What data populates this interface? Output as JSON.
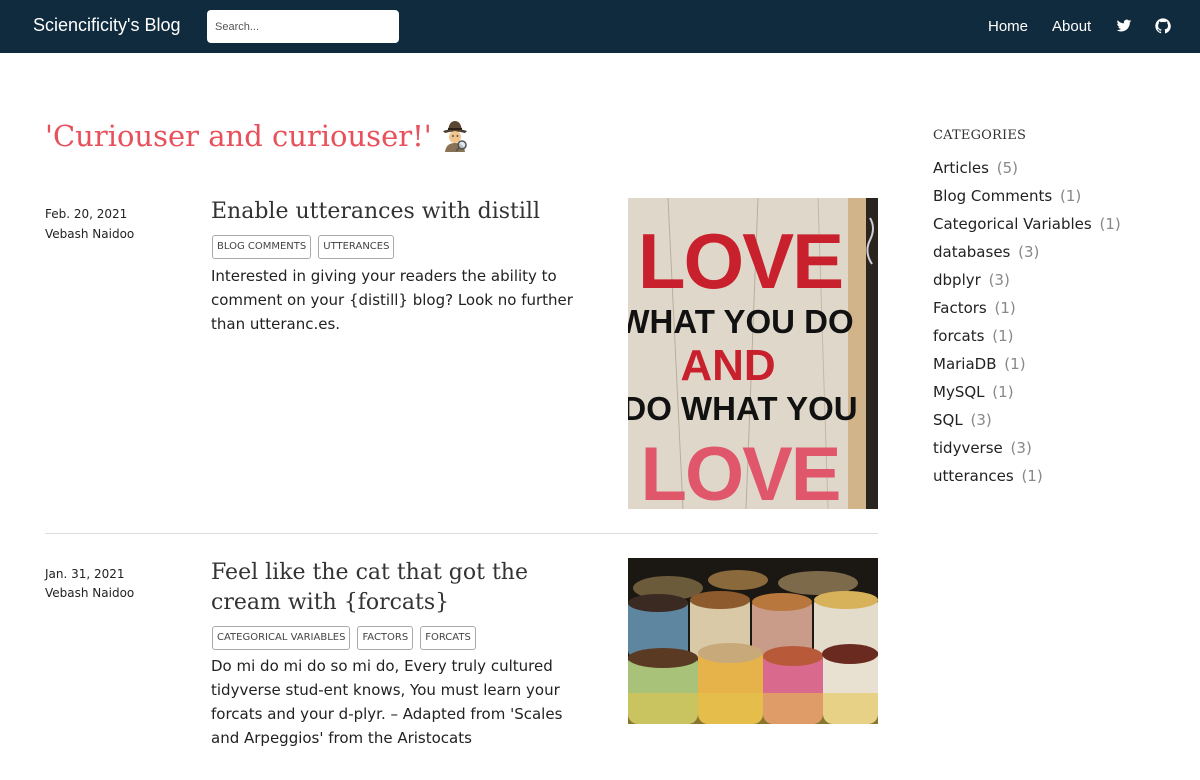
{
  "nav": {
    "brand": "Sciencificity's Blog",
    "search_placeholder": "Search...",
    "home": "Home",
    "about": "About",
    "twitter_icon": "twitter-icon",
    "github_icon": "github-icon"
  },
  "page": {
    "title": "'Curiouser and curiouser!'",
    "title_emoji": "detective-emoji"
  },
  "posts": [
    {
      "date": "Feb. 20, 2021",
      "author": "Vebash Naidoo",
      "title": "Enable utterances with distill",
      "tags": [
        "BLOG COMMENTS",
        "UTTERANCES"
      ],
      "description": "Interested in giving your readers the ability to comment on your {distill} blog? Look no further than utteranc.es.",
      "thumbnail": {
        "kind": "wooden-sign",
        "lines": [
          "LOVE",
          "WHAT YOU DO",
          "AND",
          "DO WHAT YOU",
          "LOVE"
        ]
      }
    },
    {
      "date": "Jan. 31, 2021",
      "author": "Vebash Naidoo",
      "title": "Feel like the cat that got the cream with {forcats}",
      "tags": [
        "CATEGORICAL VARIABLES",
        "FACTORS",
        "FORCATS"
      ],
      "description": "Do mi do mi do so mi do, Every truly cultured tidyverse stud-ent knows, You must learn your forcats and your d-plyr. – Adapted from 'Scales and Arpeggios' from the Aristocats",
      "thumbnail": {
        "kind": "spice-sacks"
      }
    }
  ],
  "sidebar": {
    "heading": "CATEGORIES",
    "categories": [
      {
        "name": "Articles",
        "count": "(5)"
      },
      {
        "name": "Blog Comments",
        "count": "(1)"
      },
      {
        "name": "Categorical Variables",
        "count": "(1)"
      },
      {
        "name": "databases",
        "count": "(3)"
      },
      {
        "name": "dbplyr",
        "count": "(3)"
      },
      {
        "name": "Factors",
        "count": "(1)"
      },
      {
        "name": "forcats",
        "count": "(1)"
      },
      {
        "name": "MariaDB",
        "count": "(1)"
      },
      {
        "name": "MySQL",
        "count": "(1)"
      },
      {
        "name": "SQL",
        "count": "(3)"
      },
      {
        "name": "tidyverse",
        "count": "(3)"
      },
      {
        "name": "utterances",
        "count": "(1)"
      }
    ]
  },
  "colors": {
    "navbar": "#0f2b3d",
    "title": "#e8505b",
    "sign_red": "#c8202c",
    "sign_pink": "#e0566a"
  }
}
